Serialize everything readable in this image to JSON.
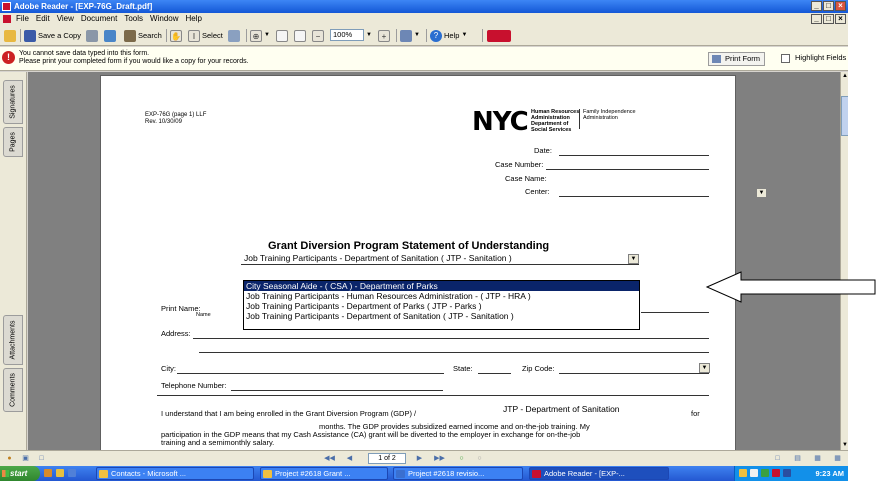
{
  "window": {
    "title": "Adobe Reader - [EXP-76G_Draft.pdf]",
    "controls": [
      "_",
      "□",
      "×"
    ]
  },
  "menu": [
    "File",
    "Edit",
    "View",
    "Document",
    "Tools",
    "Window",
    "Help"
  ],
  "toolbar": {
    "save_copy": "Save a Copy",
    "search": "Search",
    "select": "Select",
    "zoom": "100%",
    "help": "Help"
  },
  "message": {
    "line1": "You cannot save data typed into this form.",
    "line2": "Please print your completed form if you would like a copy for your records.",
    "print_form": "Print Form",
    "highlight_fields": "Highlight Fields"
  },
  "side_tabs": [
    "Signatures",
    "Pages",
    "Attachments",
    "Comments"
  ],
  "document": {
    "form_id": "EXP-76G (page 1) LLF",
    "rev": "Rev. 10/30/09",
    "logo": "NYC",
    "agency1": [
      "Human Resources",
      "Administration",
      "Department of",
      "Social Services"
    ],
    "agency2": [
      "Family Independence",
      "Administration"
    ],
    "date_label": "Date:",
    "case_number_label": "Case Number:",
    "case_name_label": "Case Name:",
    "center_label": "Center:",
    "heading": "Grant Diversion Program Statement of Understanding",
    "program_selected": "Job Training Participants - Department of Sanitation  ( JTP - Sanitation )",
    "dropdown_options": [
      "City Seasonal Aide - ( CSA ) - Department of Parks",
      "Job Training Participants - Human Resources Administration - ( JTP - HRA )",
      "Job Training Participants - Department of Parks ( JTP - Parks )",
      "Job Training Participants - Department of Sanitation  ( JTP - Sanitation )"
    ],
    "print_name_label": "Print Name:",
    "name_sublabel": "Name",
    "address_label": "Address:",
    "city_label": "City:",
    "state_label": "State:",
    "zip_label": "Zip Code:",
    "telephone_label": "Telephone Number:",
    "para1_start": "I understand that I am being enrolled in the Grant Diversion Program (GDP) /",
    "para1_program": "JTP - Department of Sanitation",
    "para1_end": "for",
    "para2": "months. The GDP provides subsidized earned income and on-the-job training. My",
    "para3": "participation in the GDP means that my Cash Assistance (CA) grant will be diverted to the employer in exchange for on-the-job",
    "para4": "training and a semimonthly salary."
  },
  "status": {
    "page_indicator": "1 of 2"
  },
  "taskbar": {
    "start": "start",
    "items": [
      "Contacts - Microsoft ...",
      "Project #2618 Grant ...",
      "Project #2618 revisio...",
      "Adobe Reader - [EXP-..."
    ],
    "clock": "9:23 AM"
  }
}
